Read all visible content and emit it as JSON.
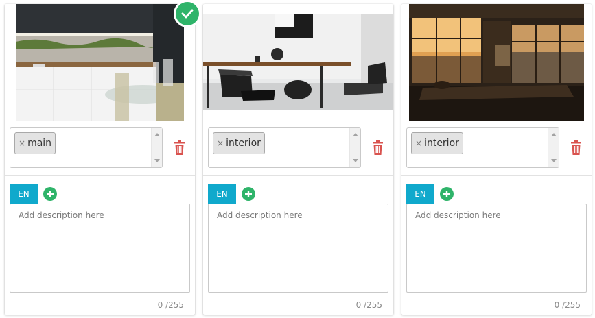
{
  "cards": [
    {
      "image_alt": "Modern kitchen with white cabinets and glass table",
      "is_main": true,
      "tags": [
        "main"
      ],
      "language_tab": "EN",
      "description_placeholder": "Add description here",
      "counter": "0 /255"
    },
    {
      "image_alt": "Dining room with wooden table and black chairs",
      "is_main": false,
      "tags": [
        "interior"
      ],
      "language_tab": "EN",
      "description_placeholder": "Add description here",
      "counter": "0 /255"
    },
    {
      "image_alt": "Apartment living room with city view at sunset",
      "is_main": false,
      "tags": [
        "interior"
      ],
      "language_tab": "EN",
      "description_placeholder": "Add description here",
      "counter": "0 /255"
    }
  ],
  "icons": {
    "main_badge": "check-circle-icon",
    "tag_remove": "close-icon",
    "delete": "trash-icon",
    "add_language": "plus-circle-icon"
  },
  "colors": {
    "accent": "#10a9cc",
    "success": "#2fb46a",
    "danger": "#d9534f"
  }
}
